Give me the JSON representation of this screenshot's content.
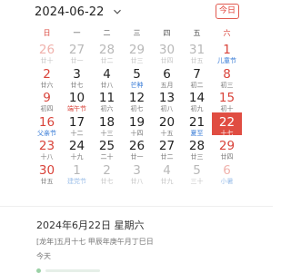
{
  "header": {
    "month": "2024-06-22",
    "today_button": "今日",
    "weekdays": [
      "日",
      "一",
      "二",
      "三",
      "四",
      "五",
      "六"
    ]
  },
  "days": [
    {
      "num": "26",
      "sub": "廿十",
      "other": true,
      "weekend": true,
      "sub_color": ""
    },
    {
      "num": "27",
      "sub": "廿一",
      "other": true,
      "weekend": false,
      "sub_color": ""
    },
    {
      "num": "28",
      "sub": "廿二",
      "other": true,
      "weekend": false,
      "sub_color": ""
    },
    {
      "num": "29",
      "sub": "廿三",
      "other": true,
      "weekend": false,
      "sub_color": ""
    },
    {
      "num": "30",
      "sub": "廿四",
      "other": true,
      "weekend": false,
      "sub_color": ""
    },
    {
      "num": "31",
      "sub": "廿五",
      "other": true,
      "weekend": false,
      "sub_color": ""
    },
    {
      "num": "1",
      "sub": "儿童节",
      "other": false,
      "weekend": true,
      "sub_color": "blue"
    },
    {
      "num": "2",
      "sub": "廿六",
      "other": false,
      "weekend": true,
      "sub_color": ""
    },
    {
      "num": "3",
      "sub": "廿七",
      "other": false,
      "weekend": false,
      "sub_color": ""
    },
    {
      "num": "4",
      "sub": "廿八",
      "other": false,
      "weekend": false,
      "sub_color": ""
    },
    {
      "num": "5",
      "sub": "芒种",
      "other": false,
      "weekend": false,
      "sub_color": "blue"
    },
    {
      "num": "6",
      "sub": "五月",
      "other": false,
      "weekend": false,
      "sub_color": ""
    },
    {
      "num": "7",
      "sub": "初二",
      "other": false,
      "weekend": false,
      "sub_color": ""
    },
    {
      "num": "8",
      "sub": "初三",
      "other": false,
      "weekend": true,
      "sub_color": ""
    },
    {
      "num": "9",
      "sub": "初四",
      "other": false,
      "weekend": true,
      "sub_color": ""
    },
    {
      "num": "10",
      "sub": "端午节",
      "other": false,
      "weekend": false,
      "sub_color": "red"
    },
    {
      "num": "11",
      "sub": "初六",
      "other": false,
      "weekend": false,
      "sub_color": ""
    },
    {
      "num": "12",
      "sub": "初七",
      "other": false,
      "weekend": false,
      "sub_color": ""
    },
    {
      "num": "13",
      "sub": "初八",
      "other": false,
      "weekend": false,
      "sub_color": ""
    },
    {
      "num": "14",
      "sub": "初九",
      "other": false,
      "weekend": false,
      "sub_color": ""
    },
    {
      "num": "15",
      "sub": "初十",
      "other": false,
      "weekend": true,
      "sub_color": ""
    },
    {
      "num": "16",
      "sub": "父亲节",
      "other": false,
      "weekend": true,
      "sub_color": "blue"
    },
    {
      "num": "17",
      "sub": "十二",
      "other": false,
      "weekend": false,
      "sub_color": ""
    },
    {
      "num": "18",
      "sub": "十三",
      "other": false,
      "weekend": false,
      "sub_color": ""
    },
    {
      "num": "19",
      "sub": "十四",
      "other": false,
      "weekend": false,
      "sub_color": ""
    },
    {
      "num": "20",
      "sub": "十五",
      "other": false,
      "weekend": false,
      "sub_color": ""
    },
    {
      "num": "21",
      "sub": "夏至",
      "other": false,
      "weekend": false,
      "sub_color": "blue"
    },
    {
      "num": "22",
      "sub": "十七",
      "other": false,
      "weekend": true,
      "sub_color": "",
      "selected": true
    },
    {
      "num": "23",
      "sub": "十八",
      "other": false,
      "weekend": true,
      "sub_color": ""
    },
    {
      "num": "24",
      "sub": "十九",
      "other": false,
      "weekend": false,
      "sub_color": ""
    },
    {
      "num": "25",
      "sub": "二十",
      "other": false,
      "weekend": false,
      "sub_color": ""
    },
    {
      "num": "26",
      "sub": "廿一",
      "other": false,
      "weekend": false,
      "sub_color": ""
    },
    {
      "num": "27",
      "sub": "廿二",
      "other": false,
      "weekend": false,
      "sub_color": ""
    },
    {
      "num": "28",
      "sub": "廿三",
      "other": false,
      "weekend": false,
      "sub_color": ""
    },
    {
      "num": "29",
      "sub": "廿四",
      "other": false,
      "weekend": true,
      "sub_color": ""
    },
    {
      "num": "30",
      "sub": "廿五",
      "other": false,
      "weekend": true,
      "sub_color": ""
    },
    {
      "num": "1",
      "sub": "建党节",
      "other": true,
      "weekend": false,
      "sub_color": "blue"
    },
    {
      "num": "2",
      "sub": "廿七",
      "other": true,
      "weekend": false,
      "sub_color": ""
    },
    {
      "num": "3",
      "sub": "廿八",
      "other": true,
      "weekend": false,
      "sub_color": ""
    },
    {
      "num": "4",
      "sub": "廿九",
      "other": true,
      "weekend": false,
      "sub_color": ""
    },
    {
      "num": "5",
      "sub": "三十",
      "other": true,
      "weekend": false,
      "sub_color": ""
    },
    {
      "num": "6",
      "sub": "小暑",
      "other": true,
      "weekend": true,
      "sub_color": "blue"
    }
  ],
  "info": {
    "date": "2024年6月22日 星期六",
    "lunar": "[龙年]五月十七 甲辰年庚午月丁巳日",
    "today": "今天"
  },
  "colors": {
    "accent": "#e04d42",
    "weekend": "#d9433a",
    "festival": "#3479d6"
  }
}
